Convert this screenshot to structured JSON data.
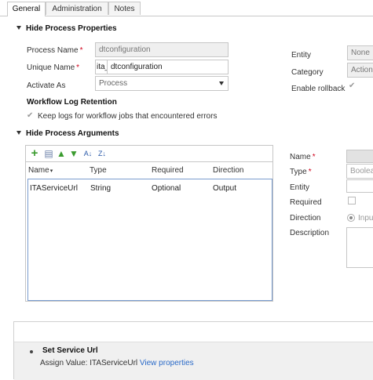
{
  "tabs": [
    {
      "label": "General"
    },
    {
      "label": "Administration"
    },
    {
      "label": "Notes"
    }
  ],
  "properties": {
    "section_title": "Hide Process Properties",
    "process_name_label": "Process Name",
    "process_name_value": "dtconfiguration",
    "unique_name_label": "Unique Name",
    "unique_name_prefix": "ita_",
    "unique_name_value": "dtconfiguration",
    "activate_as_label": "Activate As",
    "activate_as_value": "Process",
    "entity_label": "Entity",
    "entity_value": "None",
    "category_label": "Category",
    "category_value": "Action",
    "enable_rollback_label": "Enable rollback",
    "log_retention_title": "Workflow Log Retention",
    "keep_logs_label": "Keep logs for workflow jobs that encountered errors"
  },
  "arguments": {
    "section_title": "Hide Process Arguments",
    "columns": [
      "Name",
      "Type",
      "Required",
      "Direction"
    ],
    "rows": [
      {
        "name": "ITAServiceUrl",
        "type": "String",
        "required": "Optional",
        "direction": "Output"
      }
    ],
    "detail": {
      "name_label": "Name",
      "type_label": "Type",
      "type_value": "Boolea",
      "entity_label": "Entity",
      "required_label": "Required",
      "direction_label": "Direction",
      "direction_value": "Inpu",
      "description_label": "Description"
    }
  },
  "step": {
    "title": "Set Service Url",
    "assign_label": "Assign Value:",
    "assign_target": "ITAServiceUrl",
    "link": "View properties"
  },
  "toolbar": {
    "icons": [
      "add-icon",
      "edit-icon",
      "move-up-icon",
      "move-down-icon",
      "sort-ascending-icon",
      "sort-descending-icon"
    ]
  }
}
